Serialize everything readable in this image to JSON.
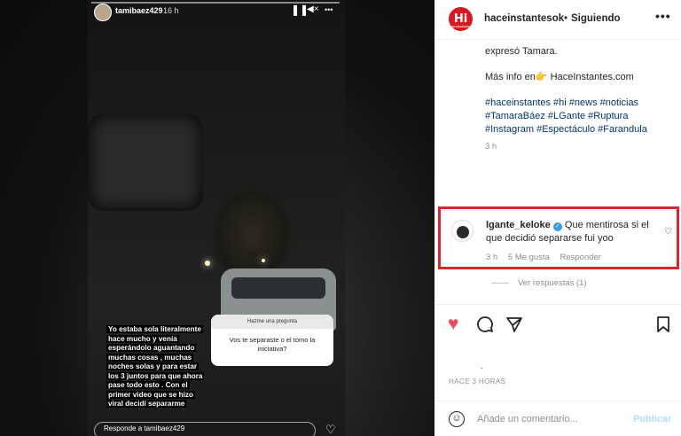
{
  "story": {
    "username": "tamibaez429",
    "time": "16 h",
    "pause_icon": "pause-icon",
    "mute_icon": "mute-icon",
    "more_label": "•••",
    "caption": "Yo estaba sola literalmente hace mucho y venía esperándolo aguantando muchas cosas , muchas noches solas y para estar los 3 juntos para que ahora pase todo esto . Con el primer video que se hizo viral decidí separarme",
    "question_header": "Hazme una pregunta",
    "question_text": "Vos te separaste o el tomo la iniciativa?",
    "reply_placeholder": "Responde a tamibaez429"
  },
  "post": {
    "logo_text": "Hi",
    "logo_sub": "HaceInstantes",
    "account": "haceinstantesok",
    "dot": "•",
    "follow_status": "Siguiendo",
    "more_label": "•••",
    "text_line1": "expresó Tamara.",
    "more_info_prefix": "Más info en",
    "more_info_emoji": "👉",
    "more_info_link": "HaceInstantes.com",
    "hashtags_1": "#haceinstantes #hi #news #noticias",
    "hashtags_2": "#TamaraBáez #LGante #Ruptura",
    "hashtags_3": "#Instagram #Espectáculo #Farandula",
    "caption_time": "3 h"
  },
  "comment": {
    "user": "lgante_keloke",
    "verified_mark": "✓",
    "text": "Que mentirosa si el que decidió separarse fui yoo",
    "time": "3 h",
    "likes": "5 Me gusta",
    "reply": "Responder",
    "view_replies": "Ver respuestas (1)"
  },
  "actions": {
    "liked": true,
    "accent": "#ed4956",
    "likes_text": ".",
    "date": "HACE 3 HORAS"
  },
  "composer": {
    "placeholder": "Añade un comentario...",
    "publish": "Publicar"
  },
  "colors": {
    "highlight_border": "#d7262c",
    "link": "#00376b",
    "muted": "#8e8e8e",
    "publish_disabled": "#b2dffc"
  }
}
